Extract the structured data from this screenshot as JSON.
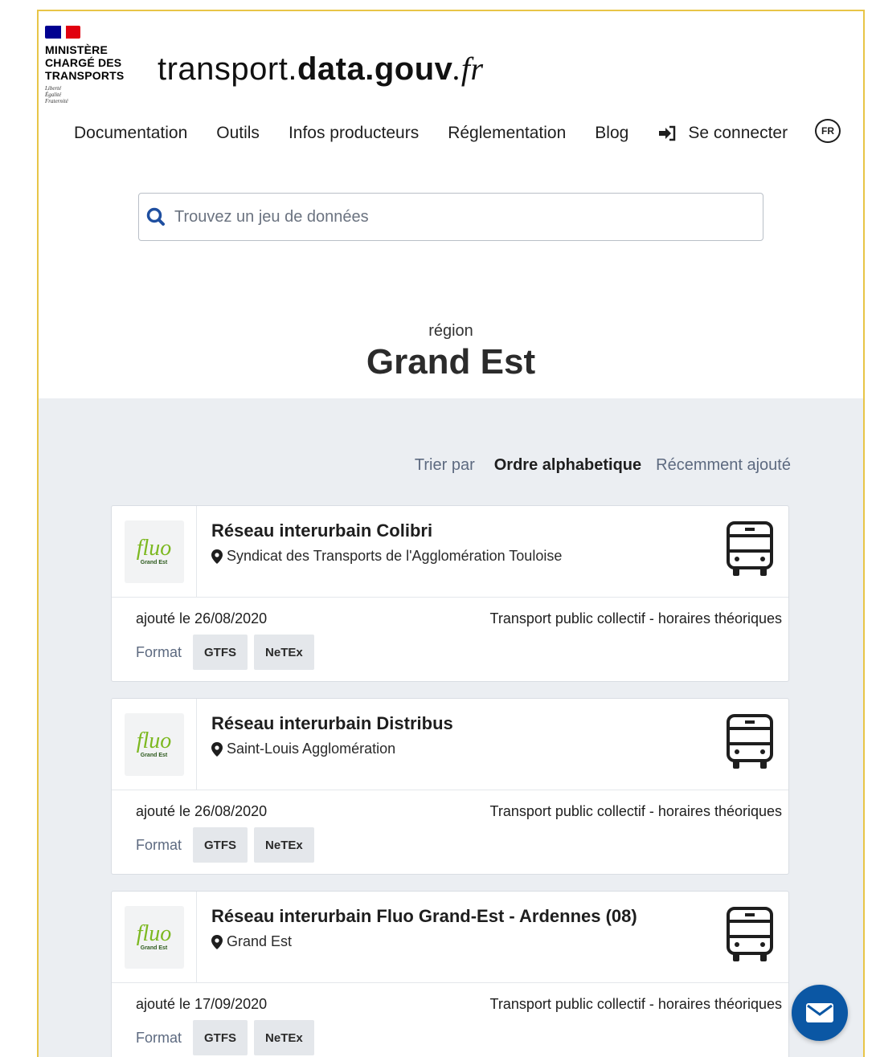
{
  "header": {
    "ministry_lines": [
      "MINISTÈRE",
      "CHARGÉ DES",
      "TRANSPORTS"
    ],
    "motto_lines": [
      "Liberté",
      "Égalité",
      "Fraternité"
    ],
    "site_title": {
      "part1": "transport.",
      "part2": "data.gouv",
      "part3": ".fr"
    }
  },
  "nav": {
    "items": [
      "Documentation",
      "Outils",
      "Infos producteurs",
      "Réglementation",
      "Blog"
    ],
    "login_label": "Se connecter",
    "lang": "FR"
  },
  "search": {
    "placeholder": "Trouvez un jeu de données"
  },
  "region": {
    "kind": "région",
    "name": "Grand Est"
  },
  "sort": {
    "label": "Trier par",
    "active": "Ordre alphabetique",
    "other": "Récemment ajouté"
  },
  "datasets": [
    {
      "title": "Réseau interurbain Colibri",
      "place": "Syndicat des Transports de l'Agglomération Touloise",
      "added": "ajouté le 26/08/2020",
      "kind": "Transport public collectif - horaires théoriques",
      "format_label": "Format",
      "formats": [
        "GTFS",
        "NeTEx"
      ],
      "logo": {
        "word": "fluo",
        "sub": "Grand Est"
      }
    },
    {
      "title": "Réseau interurbain Distribus",
      "place": "Saint-Louis Agglomération",
      "added": "ajouté le 26/08/2020",
      "kind": "Transport public collectif - horaires théoriques",
      "format_label": "Format",
      "formats": [
        "GTFS",
        "NeTEx"
      ],
      "logo": {
        "word": "fluo",
        "sub": "Grand Est"
      }
    },
    {
      "title": "Réseau interurbain Fluo Grand-Est - Ardennes (08)",
      "place": "Grand Est",
      "added": "ajouté le 17/09/2020",
      "kind": "Transport public collectif - horaires théoriques",
      "format_label": "Format",
      "formats": [
        "GTFS",
        "NeTEx"
      ],
      "logo": {
        "word": "fluo",
        "sub": "Grand Est"
      }
    }
  ],
  "colors": {
    "frame_border": "#e8c547",
    "grey_bg": "#ebeef2",
    "accent_blue": "#0b57a4",
    "search_icon": "#1f4fa0",
    "fluo_green": "#7cb820"
  },
  "icons": {
    "search": "search-icon",
    "login": "login-arrow-icon",
    "pin": "map-pin-icon",
    "bus": "bus-icon",
    "contact": "envelope-icon"
  }
}
